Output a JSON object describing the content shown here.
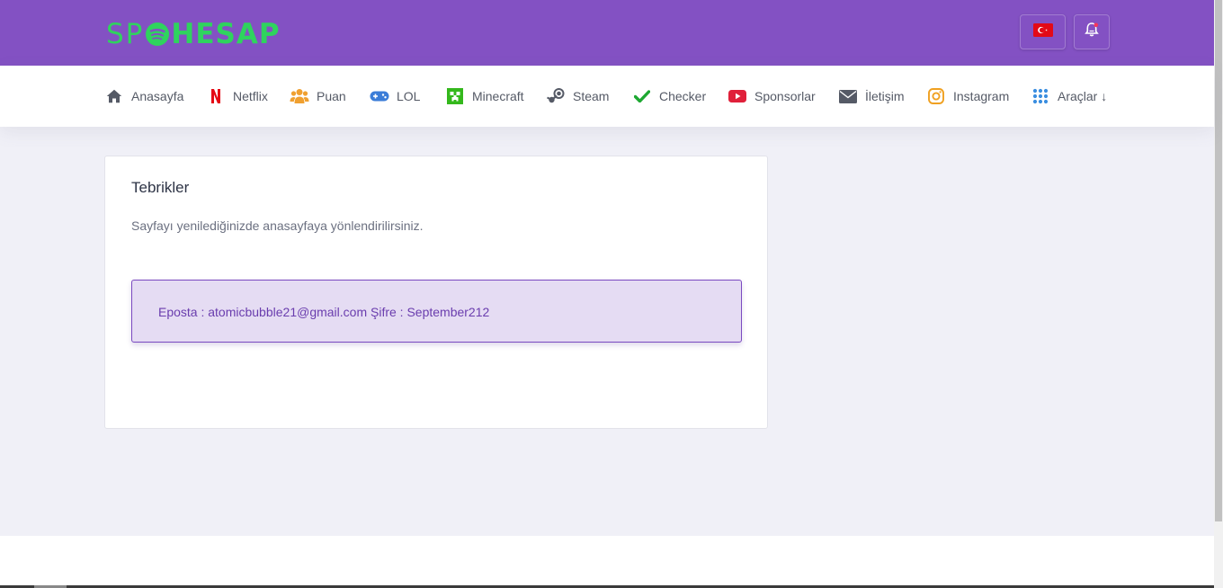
{
  "header": {
    "logo_left": "SP",
    "logo_right": "HESAP",
    "logo_icon": "spotify-icon",
    "language_icon": "turkey-flag-icon",
    "notification_icon": "bell-icon"
  },
  "nav": {
    "items": [
      {
        "label": "Anasayfa",
        "icon": "home-icon"
      },
      {
        "label": "Netflix",
        "icon": "netflix-icon"
      },
      {
        "label": "Puan",
        "icon": "users-icon"
      },
      {
        "label": "LOL",
        "icon": "gamepad-icon"
      },
      {
        "label": "Minecraft",
        "icon": "minecraft-icon"
      },
      {
        "label": "Steam",
        "icon": "steam-icon"
      },
      {
        "label": "Checker",
        "icon": "check-icon"
      },
      {
        "label": "Sponsorlar",
        "icon": "youtube-icon"
      },
      {
        "label": "İletişim",
        "icon": "envelope-icon"
      },
      {
        "label": "Instagram",
        "icon": "instagram-icon"
      },
      {
        "label": "Araçlar ↓",
        "icon": "grid-icon"
      }
    ]
  },
  "card": {
    "title": "Tebrikler",
    "text": "Sayfayı yenilediğinizde anasayfaya yönlendirilirsiniz.",
    "alert": "Eposta : atomicbubble21@gmail.com Şifre : September212"
  },
  "colors": {
    "header_bg": "#8351c3",
    "logo_green": "#2fd35e",
    "page_bg": "#f0f0f7",
    "alert_bg": "#e5dcf3",
    "alert_border": "#7a49c0",
    "alert_text": "#6a3dae"
  }
}
